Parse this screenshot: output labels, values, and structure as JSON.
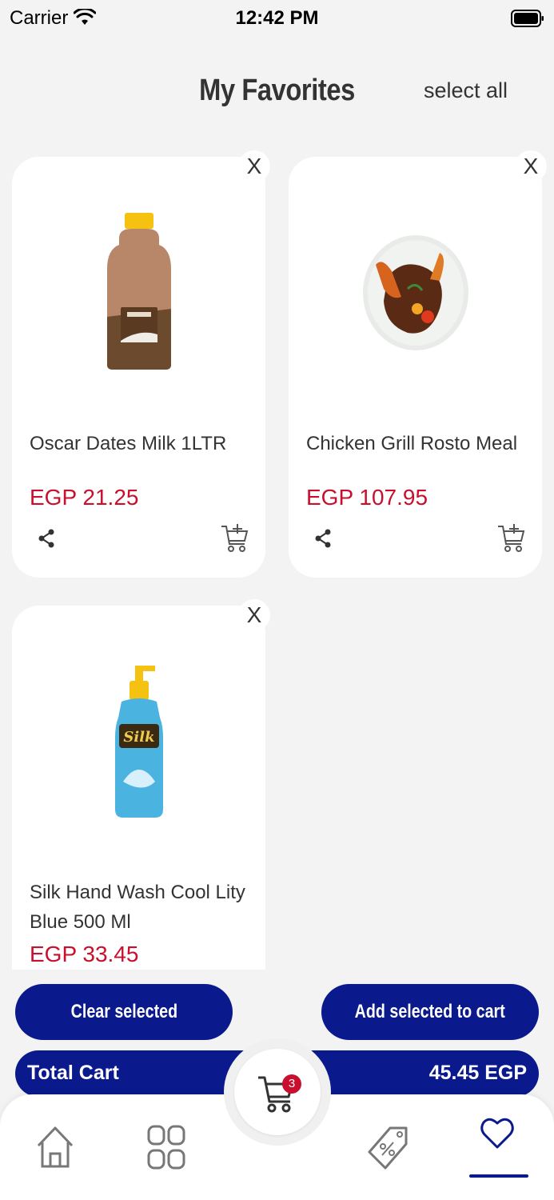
{
  "status_bar": {
    "carrier": "Carrier",
    "time": "12:42 PM"
  },
  "header": {
    "title": "My Favorites",
    "select_all": "select all"
  },
  "products": [
    {
      "name": "Oscar Dates Milk 1LTR",
      "price": "EGP 21.25",
      "remove": "X"
    },
    {
      "name": "Chicken Grill Rosto Meal",
      "price": "EGP 107.95",
      "remove": "X"
    },
    {
      "name": "Silk Hand Wash Cool Lity Blue 500 Ml",
      "price": "EGP 33.45",
      "remove": "X"
    }
  ],
  "actions": {
    "clear_selected": "Clear selected",
    "add_selected": "Add selected to cart"
  },
  "total": {
    "label": "Total Cart",
    "value": "45.45 EGP"
  },
  "nav": {
    "items": [
      "home-icon",
      "categories-icon",
      "cart-icon",
      "offers-icon",
      "favorites-icon"
    ],
    "cart_count": "3",
    "active": "favorites"
  },
  "colors": {
    "accent": "#0a1a8c",
    "price": "#c8102e",
    "background": "#f3f3f3"
  }
}
